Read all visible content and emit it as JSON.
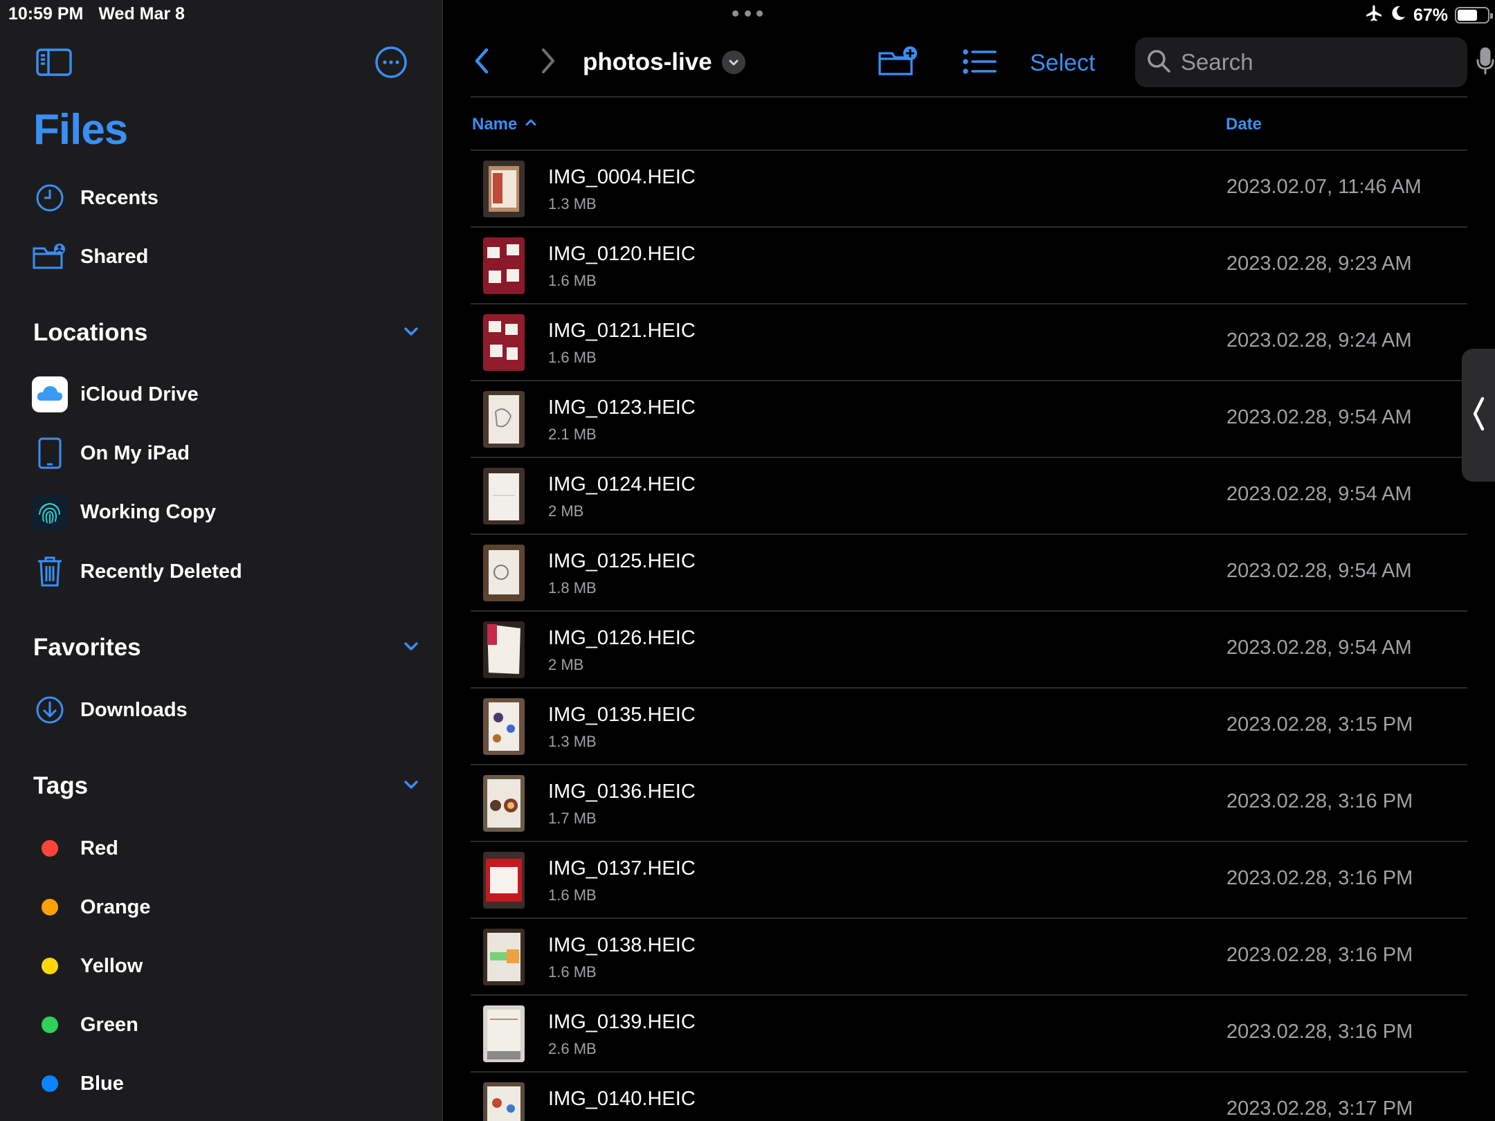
{
  "status_bar": {
    "time": "10:59 PM",
    "date": "Wed Mar 8",
    "battery_percent_text": "67%",
    "battery_level": 0.67,
    "icons": [
      "airplane-icon",
      "moon-icon",
      "battery-icon"
    ]
  },
  "sidebar": {
    "title": "Files",
    "top_icons": [
      "sidebar-toggle-icon",
      "more-icon"
    ],
    "primary_items": [
      {
        "label": "Recents",
        "icon": "clock-icon"
      },
      {
        "label": "Shared",
        "icon": "shared-folder-icon"
      }
    ],
    "sections": {
      "locations": {
        "label": "Locations",
        "items": [
          {
            "label": "iCloud Drive",
            "icon": "icloud-icon"
          },
          {
            "label": "On My iPad",
            "icon": "ipad-icon"
          },
          {
            "label": "Working Copy",
            "icon": "fingerprint-icon"
          },
          {
            "label": "Recently Deleted",
            "icon": "trash-icon"
          }
        ]
      },
      "favorites": {
        "label": "Favorites",
        "items": [
          {
            "label": "Downloads",
            "icon": "download-icon"
          }
        ]
      },
      "tags": {
        "label": "Tags",
        "items": [
          {
            "label": "Red",
            "color": "#ff453a"
          },
          {
            "label": "Orange",
            "color": "#ff9f0a"
          },
          {
            "label": "Yellow",
            "color": "#ffd60a"
          },
          {
            "label": "Green",
            "color": "#30d158"
          },
          {
            "label": "Blue",
            "color": "#0a84ff"
          }
        ]
      }
    }
  },
  "toolbar": {
    "folder_title": "photos-live",
    "select_label": "Select",
    "search_placeholder": "Search"
  },
  "columns": {
    "name": "Name",
    "date": "Date"
  },
  "accent_color": "#3a8ff5",
  "files": [
    {
      "name": "IMG_0004.HEIC",
      "size": "1.3 MB",
      "date": "2023.02.07, 11:46 AM"
    },
    {
      "name": "IMG_0120.HEIC",
      "size": "1.6 MB",
      "date": "2023.02.28, 9:23 AM"
    },
    {
      "name": "IMG_0121.HEIC",
      "size": "1.6 MB",
      "date": "2023.02.28, 9:24 AM"
    },
    {
      "name": "IMG_0123.HEIC",
      "size": "2.1 MB",
      "date": "2023.02.28, 9:54 AM"
    },
    {
      "name": "IMG_0124.HEIC",
      "size": "2 MB",
      "date": "2023.02.28, 9:54 AM"
    },
    {
      "name": "IMG_0125.HEIC",
      "size": "1.8 MB",
      "date": "2023.02.28, 9:54 AM"
    },
    {
      "name": "IMG_0126.HEIC",
      "size": "2 MB",
      "date": "2023.02.28, 9:54 AM"
    },
    {
      "name": "IMG_0135.HEIC",
      "size": "1.3 MB",
      "date": "2023.02.28, 3:15 PM"
    },
    {
      "name": "IMG_0136.HEIC",
      "size": "1.7 MB",
      "date": "2023.02.28, 3:16 PM"
    },
    {
      "name": "IMG_0137.HEIC",
      "size": "1.6 MB",
      "date": "2023.02.28, 3:16 PM"
    },
    {
      "name": "IMG_0138.HEIC",
      "size": "1.6 MB",
      "date": "2023.02.28, 3:16 PM"
    },
    {
      "name": "IMG_0139.HEIC",
      "size": "2.6 MB",
      "date": "2023.02.28, 3:16 PM"
    },
    {
      "name": "IMG_0140.HEIC",
      "size": "",
      "date": "2023.02.28, 3:17 PM"
    }
  ]
}
